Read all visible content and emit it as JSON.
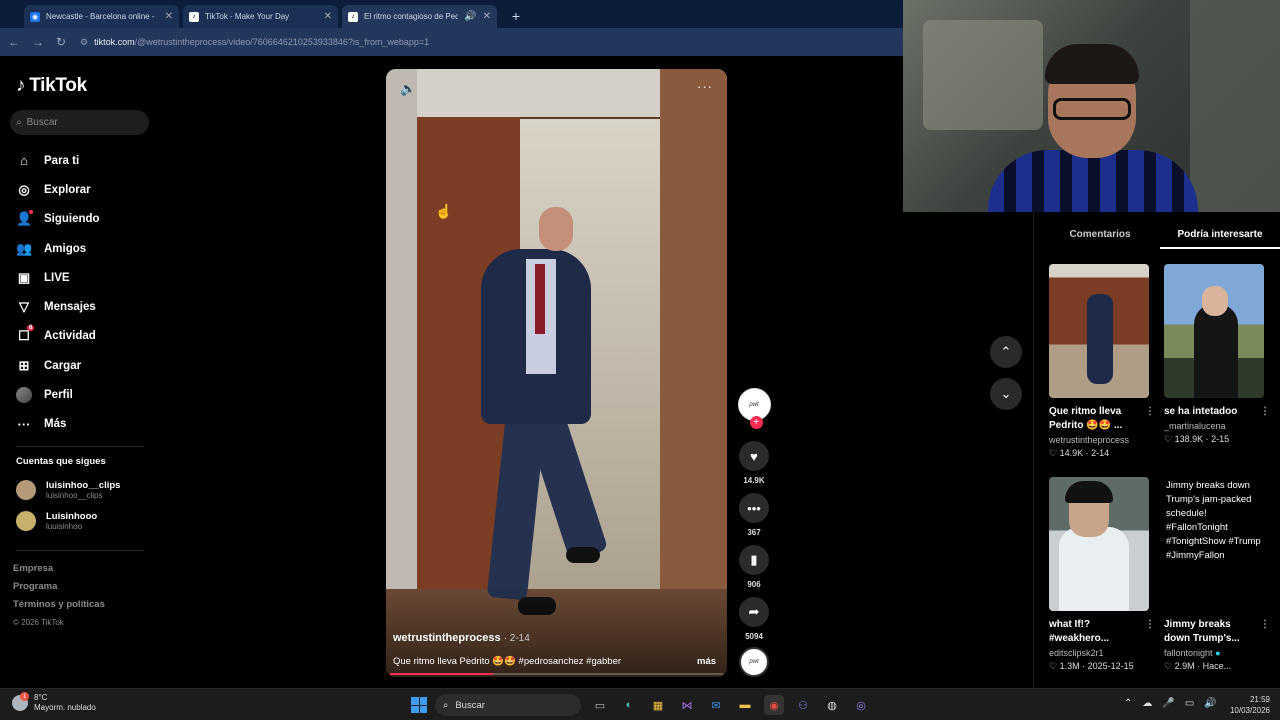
{
  "browser": {
    "tabs": [
      {
        "label": "Newcastle - Barcelona online - ",
        "icon": "newcastle-favicon"
      },
      {
        "label": "TikTok - Make Your Day",
        "icon": "tiktok-favicon"
      },
      {
        "label": "El ritmo contagioso de Pedro",
        "icon": "tiktok-favicon"
      }
    ],
    "url_domain": "tiktok.com",
    "url_path": "/@wetrustintheprocess/video/7606646210253933846?is_from_webapp=1"
  },
  "tiktok": {
    "logo": "TikTok",
    "search_placeholder": "Buscar",
    "nav": [
      {
        "label": "Para ti",
        "icon": "home-icon"
      },
      {
        "label": "Explorar",
        "icon": "compass-icon"
      },
      {
        "label": "Siguiendo",
        "icon": "following-icon"
      },
      {
        "label": "Amigos",
        "icon": "friends-icon"
      },
      {
        "label": "LIVE",
        "icon": "live-icon"
      },
      {
        "label": "Mensajes",
        "icon": "messages-icon"
      },
      {
        "label": "Actividad",
        "icon": "activity-icon",
        "badge": "6"
      },
      {
        "label": "Cargar",
        "icon": "upload-icon"
      },
      {
        "label": "Perfil",
        "icon": "profile-avatar"
      },
      {
        "label": "Más",
        "icon": "more-icon"
      }
    ],
    "following_title": "Cuentas que sigues",
    "following": [
      {
        "name": "luisinhoo__clips",
        "handle": "luisinhoo__clips"
      },
      {
        "name": "Luisinhooo",
        "handle": "luuisinhoo"
      }
    ],
    "footer": {
      "empresa": "Empresa",
      "programa": "Programa",
      "terminos": "Términos y políticas",
      "copyright": "© 2026 TikTok"
    }
  },
  "video": {
    "author": "wetrustintheprocess",
    "date": "2-14",
    "caption": "Que ritmo lleva Pedrito 🤩🤩 #pedrosanchez #gabber",
    "more_label": "más",
    "progress": 0.31,
    "likes": "14.9K",
    "comments": "367",
    "saves": "906",
    "shares": "5094",
    "avatar_text": "pwt"
  },
  "right_panel": {
    "tab_comments": "Comentarios",
    "tab_suggested": "Podría interesarte",
    "cards": [
      {
        "title": "Que ritmo lleva Pedrito 🤩🤩 ...",
        "user": "wetrustintheprocess",
        "likes": "14.9K",
        "date": "2-14"
      },
      {
        "title": "se ha intetadoo",
        "user": "_martinalucena",
        "likes": "138.9K",
        "date": "2-15"
      },
      {
        "title": "what If!? #weakhero...",
        "user": "editsclipsk2r1",
        "likes": "1.3M",
        "date": "2025-12-15"
      },
      {
        "title": "Jimmy breaks down Trump's...",
        "user": "fallontonight",
        "likes": "2.9M",
        "date": "Hace...",
        "alt": "Jimmy breaks down Trump's jam-packed schedule! #FallonTonight #TonightShow #Trump #JimmyFallon"
      }
    ]
  },
  "taskbar": {
    "temperature": "8°C",
    "weather": "Mayorm. nublado",
    "weather_badge": "1",
    "search_label": "Buscar",
    "time": "21:59",
    "date": "10/03/2026"
  }
}
